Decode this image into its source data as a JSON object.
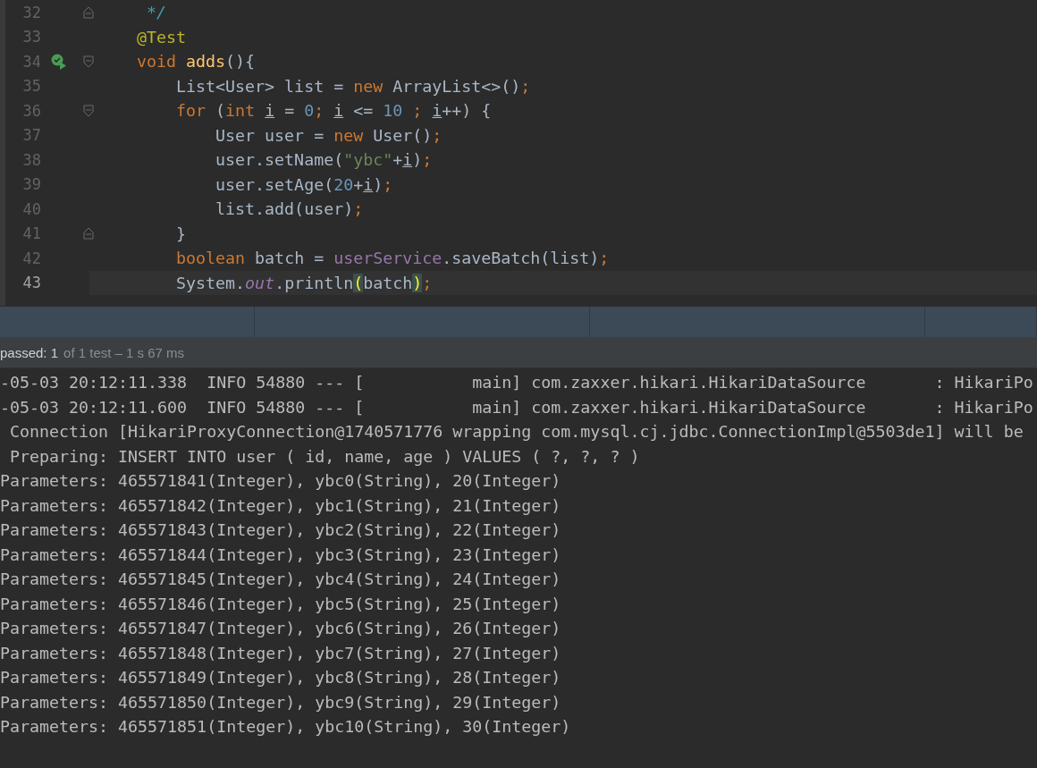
{
  "editor": {
    "lines": [
      {
        "number": "32",
        "current": false,
        "fold": {
          "kind": "end"
        },
        "run_icon": false,
        "tokens": [
          {
            "text": "     */",
            "kind": "comment"
          }
        ]
      },
      {
        "number": "33",
        "current": false,
        "run_icon": false,
        "tokens": [
          {
            "text": "    @Test",
            "kind": "annotation"
          }
        ]
      },
      {
        "number": "34",
        "current": false,
        "fold": {
          "kind": "start"
        },
        "run_icon": true,
        "tokens": [
          {
            "text": "    void ",
            "kind": "keyword"
          },
          {
            "text": "adds",
            "kind": "method"
          },
          {
            "text": "(){",
            "kind": "plain"
          }
        ]
      },
      {
        "number": "35",
        "current": false,
        "run_icon": false,
        "tokens": [
          {
            "text": "        List<User> list = ",
            "kind": "plain"
          },
          {
            "text": "new ",
            "kind": "keyword"
          },
          {
            "text": "ArrayList<>()",
            "kind": "plain"
          },
          {
            "text": ";",
            "kind": "keyword"
          }
        ]
      },
      {
        "number": "36",
        "current": false,
        "fold": {
          "kind": "start"
        },
        "run_icon": false,
        "tokens": [
          {
            "text": "        for ",
            "kind": "keyword"
          },
          {
            "text": "(",
            "kind": "plain"
          },
          {
            "text": "int ",
            "kind": "keyword"
          },
          {
            "text": "i",
            "kind": "var"
          },
          {
            "text": " = ",
            "kind": "plain"
          },
          {
            "text": "0",
            "kind": "number"
          },
          {
            "text": "; ",
            "kind": "keyword"
          },
          {
            "text": "i",
            "kind": "var"
          },
          {
            "text": " <= ",
            "kind": "plain"
          },
          {
            "text": "10",
            "kind": "number"
          },
          {
            "text": " ; ",
            "kind": "keyword"
          },
          {
            "text": "i",
            "kind": "var"
          },
          {
            "text": "++) {",
            "kind": "plain"
          }
        ]
      },
      {
        "number": "37",
        "current": false,
        "run_icon": false,
        "tokens": [
          {
            "text": "            User user = ",
            "kind": "plain"
          },
          {
            "text": "new ",
            "kind": "keyword"
          },
          {
            "text": "User()",
            "kind": "plain"
          },
          {
            "text": ";",
            "kind": "keyword"
          }
        ]
      },
      {
        "number": "38",
        "current": false,
        "run_icon": false,
        "tokens": [
          {
            "text": "            user.setName(",
            "kind": "plain"
          },
          {
            "text": "\"ybc\"",
            "kind": "string"
          },
          {
            "text": "+",
            "kind": "plain"
          },
          {
            "text": "i",
            "kind": "var"
          },
          {
            "text": ")",
            "kind": "plain"
          },
          {
            "text": ";",
            "kind": "keyword"
          }
        ]
      },
      {
        "number": "39",
        "current": false,
        "run_icon": false,
        "tokens": [
          {
            "text": "            user.setAge(",
            "kind": "plain"
          },
          {
            "text": "20",
            "kind": "number"
          },
          {
            "text": "+",
            "kind": "plain"
          },
          {
            "text": "i",
            "kind": "var"
          },
          {
            "text": ")",
            "kind": "plain"
          },
          {
            "text": ";",
            "kind": "keyword"
          }
        ]
      },
      {
        "number": "40",
        "current": false,
        "run_icon": false,
        "tokens": [
          {
            "text": "            list.add(user)",
            "kind": "plain"
          },
          {
            "text": ";",
            "kind": "keyword"
          }
        ]
      },
      {
        "number": "41",
        "current": false,
        "fold": {
          "kind": "end"
        },
        "run_icon": false,
        "tokens": [
          {
            "text": "        }",
            "kind": "plain"
          }
        ]
      },
      {
        "number": "42",
        "current": false,
        "run_icon": false,
        "tokens": [
          {
            "text": "        boolean ",
            "kind": "keyword"
          },
          {
            "text": "batch = ",
            "kind": "plain"
          },
          {
            "text": "userService",
            "kind": "field"
          },
          {
            "text": ".saveBatch(list)",
            "kind": "plain"
          },
          {
            "text": ";",
            "kind": "keyword"
          }
        ]
      },
      {
        "number": "43",
        "current": true,
        "run_icon": false,
        "tokens": [
          {
            "text": "        System.",
            "kind": "plain"
          },
          {
            "text": "out",
            "kind": "static"
          },
          {
            "text": ".println",
            "kind": "plain"
          },
          {
            "text": "(",
            "kind": "match"
          },
          {
            "text": "batch",
            "kind": "plain"
          },
          {
            "text": ")",
            "kind": "match"
          },
          {
            "text": ";",
            "kind": "keyword"
          }
        ]
      }
    ]
  },
  "run_status": {
    "passed": "passed: 1",
    "detail": "of 1 test – 1 s 67 ms"
  },
  "console": [
    "-05-03 20:12:11.338  INFO 54880 --- [           main] com.zaxxer.hikari.HikariDataSource       : HikariPo",
    "-05-03 20:12:11.600  INFO 54880 --- [           main] com.zaxxer.hikari.HikariDataSource       : HikariPo",
    " Connection [HikariProxyConnection@1740571776 wrapping com.mysql.cj.jdbc.ConnectionImpl@5503de1] will be",
    " Preparing: INSERT INTO user ( id, name, age ) VALUES ( ?, ?, ? )",
    "Parameters: 465571841(Integer), ybc0(String), 20(Integer)",
    "Parameters: 465571842(Integer), ybc1(String), 21(Integer)",
    "Parameters: 465571843(Integer), ybc2(String), 22(Integer)",
    "Parameters: 465571844(Integer), ybc3(String), 23(Integer)",
    "Parameters: 465571845(Integer), ybc4(String), 24(Integer)",
    "Parameters: 465571846(Integer), ybc5(String), 25(Integer)",
    "Parameters: 465571847(Integer), ybc6(String), 26(Integer)",
    "Parameters: 465571848(Integer), ybc7(String), 27(Integer)",
    "Parameters: 465571849(Integer), ybc8(String), 28(Integer)",
    "Parameters: 465571850(Integer), ybc9(String), 29(Integer)",
    "Parameters: 465571851(Integer), ybc10(String), 30(Integer)"
  ]
}
